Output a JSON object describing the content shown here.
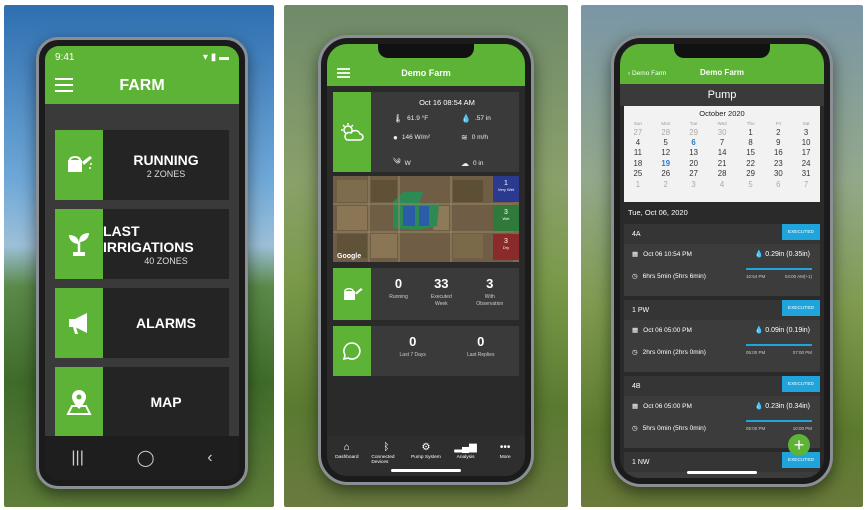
{
  "phone1": {
    "status_time": "9:41",
    "title": "FARM",
    "tiles": [
      {
        "label": "RUNNING",
        "sub": "2 ZONES",
        "icon": "watering-can-icon"
      },
      {
        "label": "LAST IRRIGATIONS",
        "sub": "40 ZONES",
        "icon": "plant-icon"
      },
      {
        "label": "ALARMS",
        "sub": "",
        "icon": "megaphone-icon"
      },
      {
        "label": "MAP",
        "sub": "",
        "icon": "map-pin-icon"
      }
    ],
    "nav": [
      "|||",
      "◯",
      "‹"
    ]
  },
  "phone2": {
    "title": "Demo Farm",
    "weather": {
      "datetime": "Oct 16 08:54 AM",
      "temp": "61.9 °F",
      "rain": ".57 in",
      "solar": "146 W/m²",
      "rain_rate": "0 m/h",
      "wind": "W",
      "evap": "0 in"
    },
    "map_badge": "Google",
    "legend": [
      {
        "num": "1",
        "label": "Very Wet",
        "color": "#2b3a8f"
      },
      {
        "num": "3",
        "label": "Wet",
        "color": "#2f7a3a"
      },
      {
        "num": "3",
        "label": "Dry",
        "color": "#8a2a2a"
      }
    ],
    "stats": [
      {
        "value": "0",
        "label": "Running"
      },
      {
        "value": "33",
        "label": "Executed Week"
      },
      {
        "value": "3",
        "label": "With Observation"
      }
    ],
    "messages": [
      {
        "value": "0",
        "label": "Last 7 Days"
      },
      {
        "value": "0",
        "label": "Last Replies"
      }
    ],
    "tabs": [
      {
        "label": "Dashboard",
        "icon": "home-icon"
      },
      {
        "label": "Connected Devices",
        "icon": "bluetooth-icon"
      },
      {
        "label": "Pump System",
        "icon": "pump-icon"
      },
      {
        "label": "Analysis",
        "icon": "bar-chart-icon"
      },
      {
        "label": "More",
        "icon": "more-icon"
      }
    ]
  },
  "phone3": {
    "back": "Demo Farm",
    "title": "Demo Farm",
    "subtitle": "Pump",
    "calendar": {
      "month": "October 2020",
      "days": [
        "Sun",
        "Mon",
        "Tue",
        "Wed",
        "Thu",
        "Fri",
        "Sat"
      ],
      "weeks": [
        [
          "27",
          "28",
          "29",
          "30",
          "1",
          "2",
          "3"
        ],
        [
          "4",
          "5",
          "6",
          "7",
          "8",
          "9",
          "10"
        ],
        [
          "11",
          "12",
          "13",
          "14",
          "15",
          "16",
          "17"
        ],
        [
          "18",
          "19",
          "20",
          "21",
          "22",
          "23",
          "24"
        ],
        [
          "25",
          "26",
          "27",
          "28",
          "29",
          "30",
          "31"
        ],
        [
          "1",
          "2",
          "3",
          "4",
          "5",
          "6",
          "7"
        ]
      ]
    },
    "selected_date": "Tue, Oct 06, 2020",
    "events": [
      {
        "zone": "4A",
        "status": "EXECUTED",
        "start": "Oct 06 10:54 PM",
        "duration": "6hrs 5min (5hrs 6min)",
        "amount": "0.29in (0.35in)",
        "from": "10:54 PM",
        "to": "04:00 AM(+1)"
      },
      {
        "zone": "1 PW",
        "status": "EXECUTED",
        "start": "Oct 06 05:00 PM",
        "duration": "2hrs 0min (2hrs 0min)",
        "amount": "0.09in (0.19in)",
        "from": "05:00 PM",
        "to": "07:00 PM"
      },
      {
        "zone": "4B",
        "status": "EXECUTED",
        "start": "Oct 06 05:00 PM",
        "duration": "5hrs 0min (5hrs 0min)",
        "amount": "0.23in (0.34in)",
        "from": "05:00 PM",
        "to": "10:00 PM"
      },
      {
        "zone": "1 NW",
        "status": "EXECUTED"
      }
    ]
  }
}
